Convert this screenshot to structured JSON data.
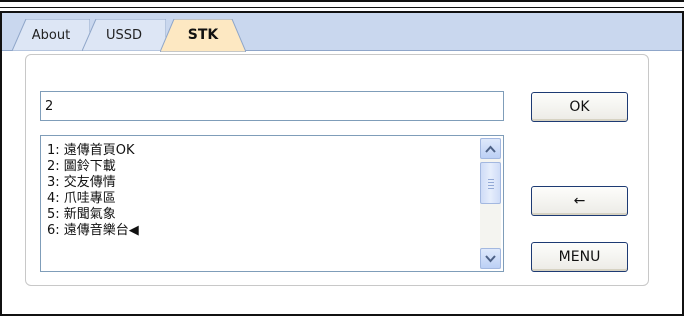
{
  "tabs": [
    {
      "label": "About"
    },
    {
      "label": "USSD"
    },
    {
      "label": "STK"
    }
  ],
  "input": {
    "value": "2"
  },
  "list": {
    "items": [
      "1: 遠傳首頁OK",
      "2: 圖鈴下載",
      "3: 交友傳情",
      "4: 爪哇專區",
      "5: 新聞氣象",
      "6: 遠傳音樂台◀"
    ]
  },
  "buttons": {
    "ok": "OK",
    "back": "←",
    "menu": "MENU"
  },
  "colors": {
    "tabbar": "#c9d7ee",
    "active_tab": "#fde8c2",
    "button_border": "#1d3a73"
  },
  "icons": {
    "scroll_up": "chevron-up-icon",
    "scroll_down": "chevron-down-icon"
  }
}
